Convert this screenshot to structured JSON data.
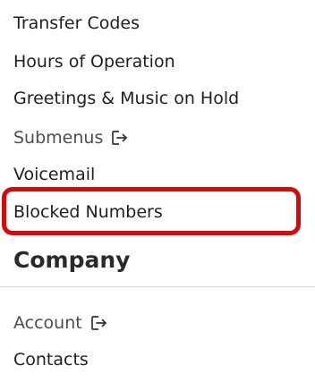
{
  "nav": {
    "items": [
      {
        "label": "Transfer Codes"
      },
      {
        "label": "Hours of Operation"
      },
      {
        "label": "Greetings & Music on Hold"
      },
      {
        "label": "Submenus",
        "icon": "external-link-icon"
      },
      {
        "label": "Voicemail"
      },
      {
        "label": "Blocked Numbers",
        "highlighted": true
      }
    ]
  },
  "company": {
    "title": "Company",
    "items": [
      {
        "label": "Account",
        "icon": "external-link-icon"
      },
      {
        "label": "Contacts"
      }
    ]
  },
  "colors": {
    "highlight": "#d9070a",
    "text": "#1f1f1f",
    "divider": "#d6d6d6"
  }
}
